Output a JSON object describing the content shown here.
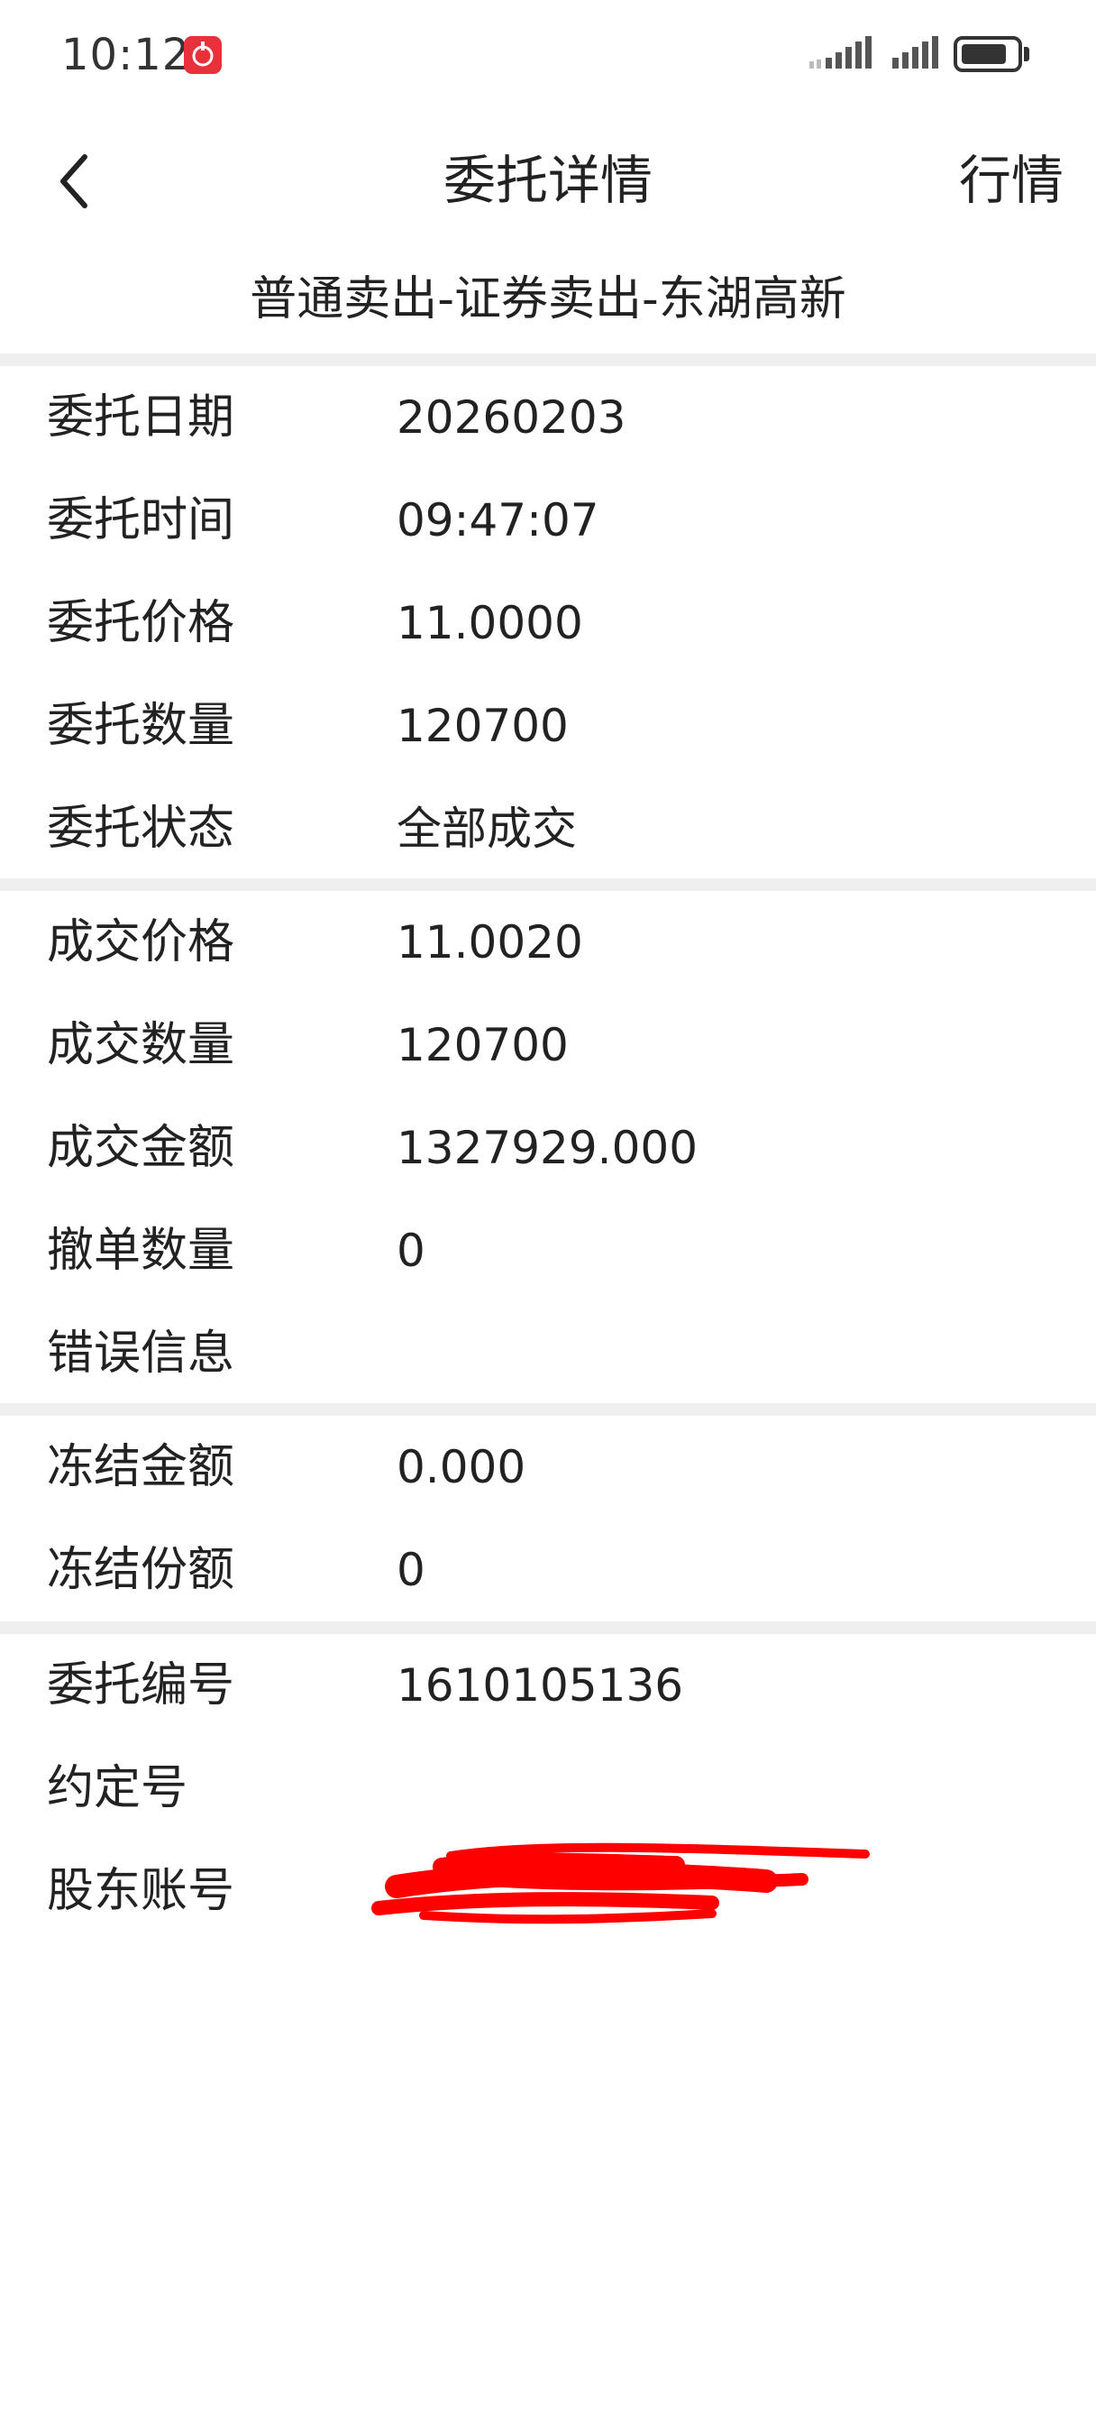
{
  "status_bar": {
    "time": "10:12",
    "app_icon": "app-notification-icon",
    "battery_level": 0.85
  },
  "nav": {
    "back_icon": "chevron-left-icon",
    "title": "委托详情",
    "action": "行情"
  },
  "subtitle": "普通卖出-证券卖出-东湖高新",
  "sections": [
    {
      "rows": [
        {
          "label": "委托日期",
          "value": "20260203"
        },
        {
          "label": "委托时间",
          "value": "09:47:07"
        },
        {
          "label": "委托价格",
          "value": "11.0000"
        },
        {
          "label": "委托数量",
          "value": "120700"
        },
        {
          "label": "委托状态",
          "value": "全部成交"
        }
      ]
    },
    {
      "rows": [
        {
          "label": "成交价格",
          "value": "11.0020"
        },
        {
          "label": "成交数量",
          "value": "120700"
        },
        {
          "label": "成交金额",
          "value": "1327929.000"
        },
        {
          "label": "撤单数量",
          "value": "0"
        },
        {
          "label": "错误信息",
          "value": ""
        }
      ]
    },
    {
      "rows": [
        {
          "label": "冻结金额",
          "value": "0.000"
        },
        {
          "label": "冻结份额",
          "value": "0"
        }
      ]
    },
    {
      "rows": [
        {
          "label": "委托编号",
          "value": "1610105136"
        },
        {
          "label": "约定号",
          "value": ""
        },
        {
          "label": "股东账号",
          "value": ""
        }
      ]
    }
  ],
  "colors": {
    "text": "#222222",
    "divider": "#efefef",
    "redaction": "#ff0000",
    "app_icon_bg": "#e8313a"
  }
}
